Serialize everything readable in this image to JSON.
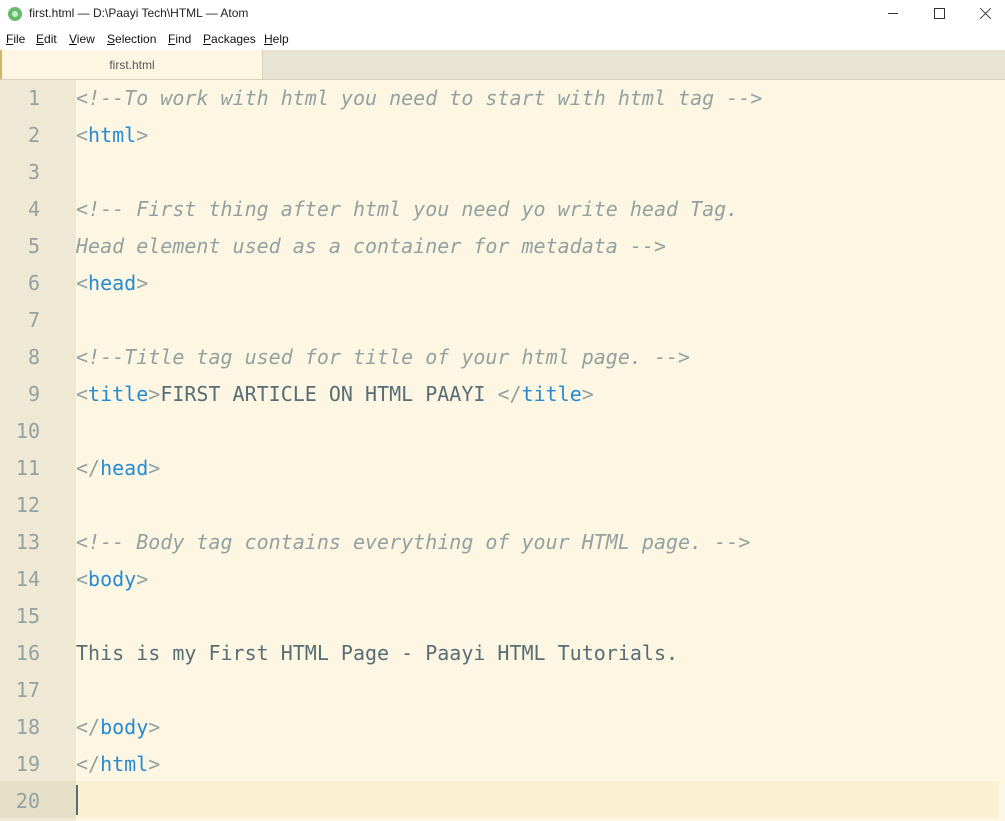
{
  "window": {
    "title": "first.html — D:\\Paayi Tech\\HTML — Atom"
  },
  "menu": [
    {
      "underline": "F",
      "rest": "ile"
    },
    {
      "underline": "E",
      "rest": "dit"
    },
    {
      "underline": "V",
      "rest": "iew"
    },
    {
      "underline": "S",
      "rest": "election"
    },
    {
      "underline": "F",
      "rest": "ind"
    },
    {
      "underline": "P",
      "rest": "ackages"
    },
    {
      "underline": "H",
      "rest": "elp"
    }
  ],
  "tab": {
    "label": "first.html"
  },
  "editor": {
    "line_numbers": [
      "1",
      "2",
      "3",
      "4",
      "5",
      "6",
      "7",
      "8",
      "9",
      "10",
      "11",
      "12",
      "13",
      "14",
      "15",
      "16",
      "17",
      "18",
      "19",
      "20"
    ],
    "line1": "<!--To work with html you need to start with html tag -->",
    "line4": "<!-- First thing after html you need yo write head Tag.",
    "line5": "Head element used as a container for metadata -->",
    "line8": "<!--Title tag used for title of your html page. -->",
    "line9_text": "FIRST ARTICLE ON HTML PAAYI ",
    "line13": "<!-- Body tag contains everything of your HTML page. -->",
    "line16": "This is my First HTML Page - Paayi HTML Tutorials.",
    "tags": {
      "lt": "<",
      "gt": ">",
      "lt_slash": "</",
      "html": "html",
      "head": "head",
      "title": "title",
      "body": "body"
    }
  },
  "colors": {
    "background": "#fdf6e3",
    "gutter": "#eee8d5",
    "comment": "#93a1a1",
    "tag": "#268bd2",
    "text": "#586e75"
  }
}
